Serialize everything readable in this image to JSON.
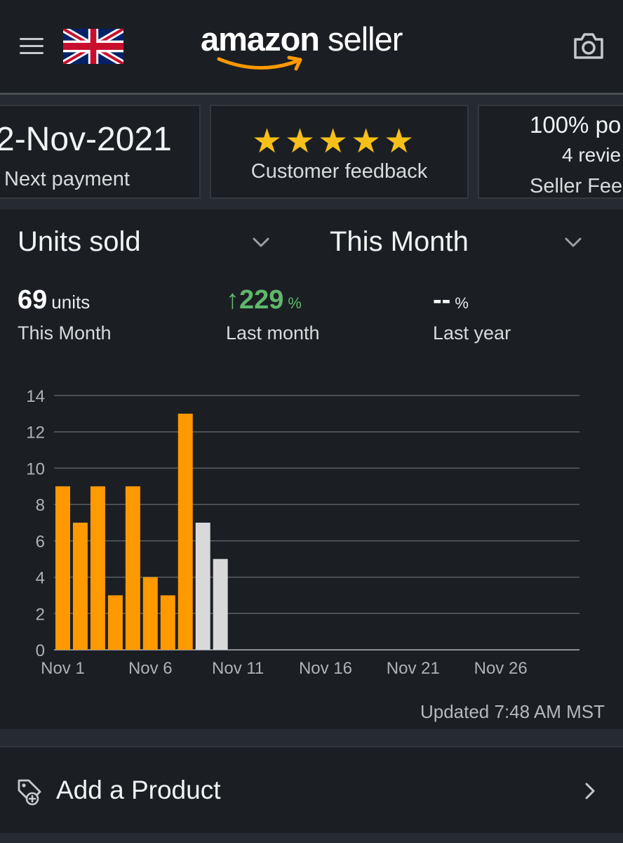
{
  "header": {
    "logo_brand": "amazon",
    "logo_rest": " seller",
    "menu_icon": "hamburger-menu-icon",
    "flag": "uk-flag-icon",
    "camera_icon": "camera-icon"
  },
  "cards": [
    {
      "title": "2-Nov-2021",
      "subtitle": "Next payment"
    },
    {
      "stars": "★★★★★",
      "rating_stars": 5,
      "subtitle": "Customer feedback"
    },
    {
      "line1": "100% po",
      "line2": "4 revie",
      "line3": "Seller Fee"
    }
  ],
  "filters": {
    "metric_select": "Units sold",
    "period_select": "This Month"
  },
  "metrics": [
    {
      "value": "69",
      "unit": "units",
      "label": "This Month"
    },
    {
      "value": "↑229",
      "unit": "%",
      "label": "Last month"
    },
    {
      "value": "--",
      "unit": "%",
      "label": "Last year"
    }
  ],
  "chart_data": {
    "type": "bar",
    "x": [
      1,
      2,
      3,
      4,
      5,
      6,
      7,
      8,
      9,
      10
    ],
    "values": [
      9,
      7,
      9,
      3,
      9,
      4,
      3,
      13,
      7,
      5
    ],
    "bar_colors": [
      "#ff9900",
      "#ff9900",
      "#ff9900",
      "#ff9900",
      "#ff9900",
      "#ff9900",
      "#ff9900",
      "#ff9900",
      "#d9d9d9",
      "#d9d9d9"
    ],
    "xticks": [
      1,
      6,
      11,
      16,
      21,
      26
    ],
    "xtick_labels": [
      "Nov 1",
      "Nov 6",
      "Nov 11",
      "Nov 16",
      "Nov 21",
      "Nov 26"
    ],
    "yticks": [
      "0",
      "2",
      "4",
      "6",
      "8",
      "10",
      "12",
      "14"
    ],
    "ylim": [
      0,
      14
    ],
    "xlim": [
      0.5,
      30.5
    ],
    "grid": true
  },
  "updated": "Updated 7:48 AM MST",
  "add_product": {
    "label": "Add a Product",
    "icon": "add-tag-icon"
  },
  "colors": {
    "background": "#1b1f24",
    "accent": "#ff9900",
    "star": "#f6c019",
    "positive": "#5fb86a"
  }
}
